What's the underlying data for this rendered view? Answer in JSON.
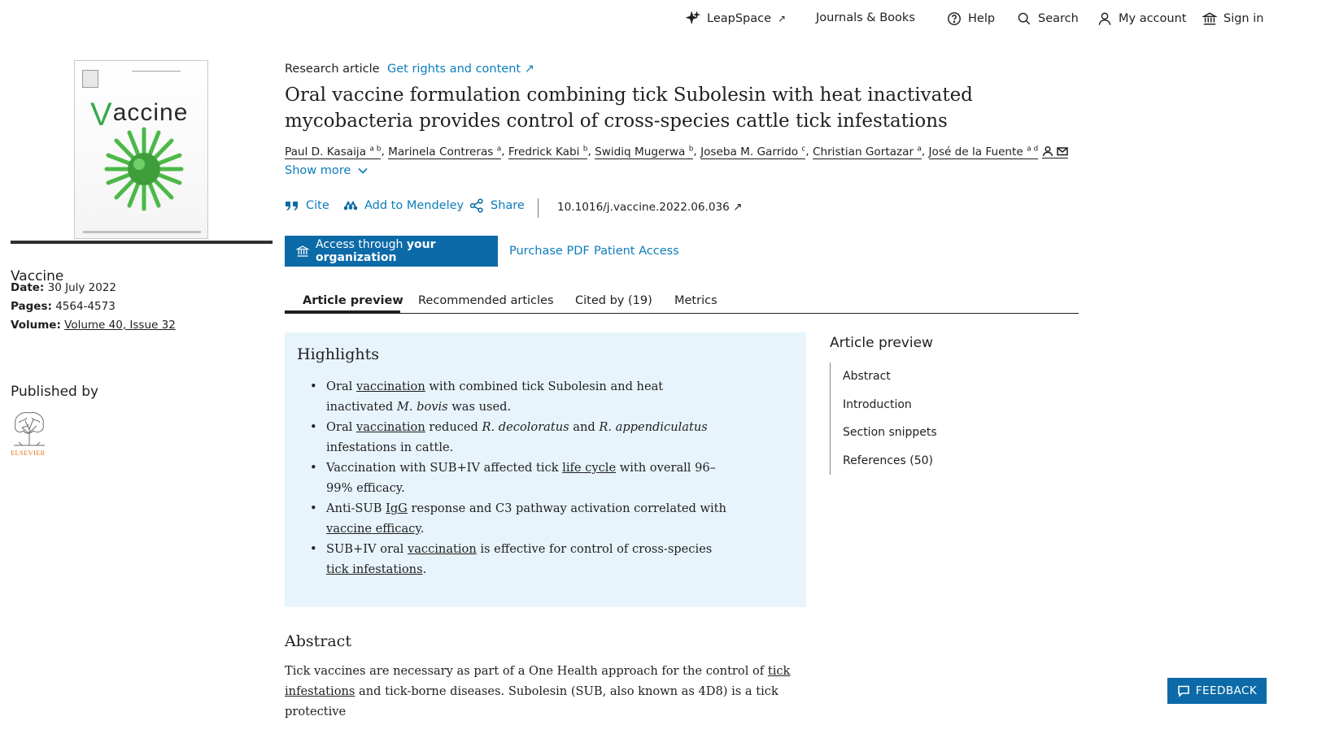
{
  "topnav": {
    "leapspace": "LeapSpace",
    "leapspace_ext": "↗",
    "journals": "Journals & Books",
    "help": "Help",
    "search": "Search",
    "account": "My account",
    "signin": "Sign in"
  },
  "sidebar": {
    "cover_title_v": "V",
    "cover_title_rest": "accine",
    "journal_name": "Vaccine",
    "date_label": "Date:",
    "date_value": "30 July 2022",
    "pages_label": "Pages:",
    "pages_value": "4564-4573",
    "volume_label": "Volume:",
    "volume_value": "Volume 40, Issue 32",
    "published_by": "Published by",
    "publisher_wordmark": "ELSEVIER"
  },
  "article": {
    "type": "Research article",
    "rights": "Get rights and content ↗",
    "title": "Oral vaccine formulation combining tick Subolesin with heat inactivated mycobacteria provides control of cross-species cattle tick infestations",
    "authors": [
      {
        "name": "Paul D. Kasaija",
        "sup": "a b"
      },
      {
        "name": "Marinela Contreras",
        "sup": "a"
      },
      {
        "name": "Fredrick Kabi",
        "sup": "b"
      },
      {
        "name": "Swidiq Mugerwa",
        "sup": "b"
      },
      {
        "name": "Joseba M. Garrido",
        "sup": "c"
      },
      {
        "name": "Christian Gortazar",
        "sup": "a"
      },
      {
        "name": "José de la Fuente",
        "sup": "a d"
      }
    ],
    "show_more": "Show more",
    "cite": "Cite",
    "mendeley": "Add to Mendeley",
    "share": "Share",
    "doi": "10.1016/j.vaccine.2022.06.036 ↗",
    "access_prefix": "Access through",
    "access_bold": "your organization",
    "purchase": "Purchase PDF",
    "patient": "Patient Access"
  },
  "tabs": [
    "Article preview",
    "Recommended articles",
    "Cited by (19)",
    "Metrics"
  ],
  "highlights": {
    "title": "Highlights",
    "items": [
      [
        {
          "t": "Oral "
        },
        {
          "t": "vaccination",
          "u": true
        },
        {
          "t": " with combined tick Subolesin and heat inactivated "
        },
        {
          "t": "M. bovis",
          "i": true
        },
        {
          "t": " was used."
        }
      ],
      [
        {
          "t": "Oral "
        },
        {
          "t": "vaccination",
          "u": true
        },
        {
          "t": " reduced "
        },
        {
          "t": "R. decoloratus",
          "i": true
        },
        {
          "t": " and "
        },
        {
          "t": "R. appendiculatus",
          "i": true
        },
        {
          "t": " infestations in cattle."
        }
      ],
      [
        {
          "t": "Vaccination with SUB+IV affected tick "
        },
        {
          "t": "life cycle",
          "u": true
        },
        {
          "t": " with overall 96–99% efficacy."
        }
      ],
      [
        {
          "t": "Anti-SUB "
        },
        {
          "t": "IgG",
          "u": true
        },
        {
          "t": " response and C3 pathway activation correlated with "
        },
        {
          "t": "vaccine efficacy",
          "u": true
        },
        {
          "t": "."
        }
      ],
      [
        {
          "t": "SUB+IV oral "
        },
        {
          "t": "vaccination",
          "u": true
        },
        {
          "t": " is effective for control of cross-species "
        },
        {
          "t": "tick infestations",
          "u": true
        },
        {
          "t": "."
        }
      ]
    ]
  },
  "abstract": {
    "title": "Abstract",
    "text": [
      {
        "t": "Tick vaccines are necessary as part of a One Health approach for the control of "
      },
      {
        "t": "tick infestations",
        "u": true
      },
      {
        "t": " and tick-borne diseases. Subolesin (SUB, also known as 4D8) is a tick protective"
      }
    ]
  },
  "toc": {
    "title": "Article preview",
    "items": [
      "Abstract",
      "Introduction",
      "Section snippets",
      "References (50)"
    ]
  },
  "feedback": "FEEDBACK"
}
